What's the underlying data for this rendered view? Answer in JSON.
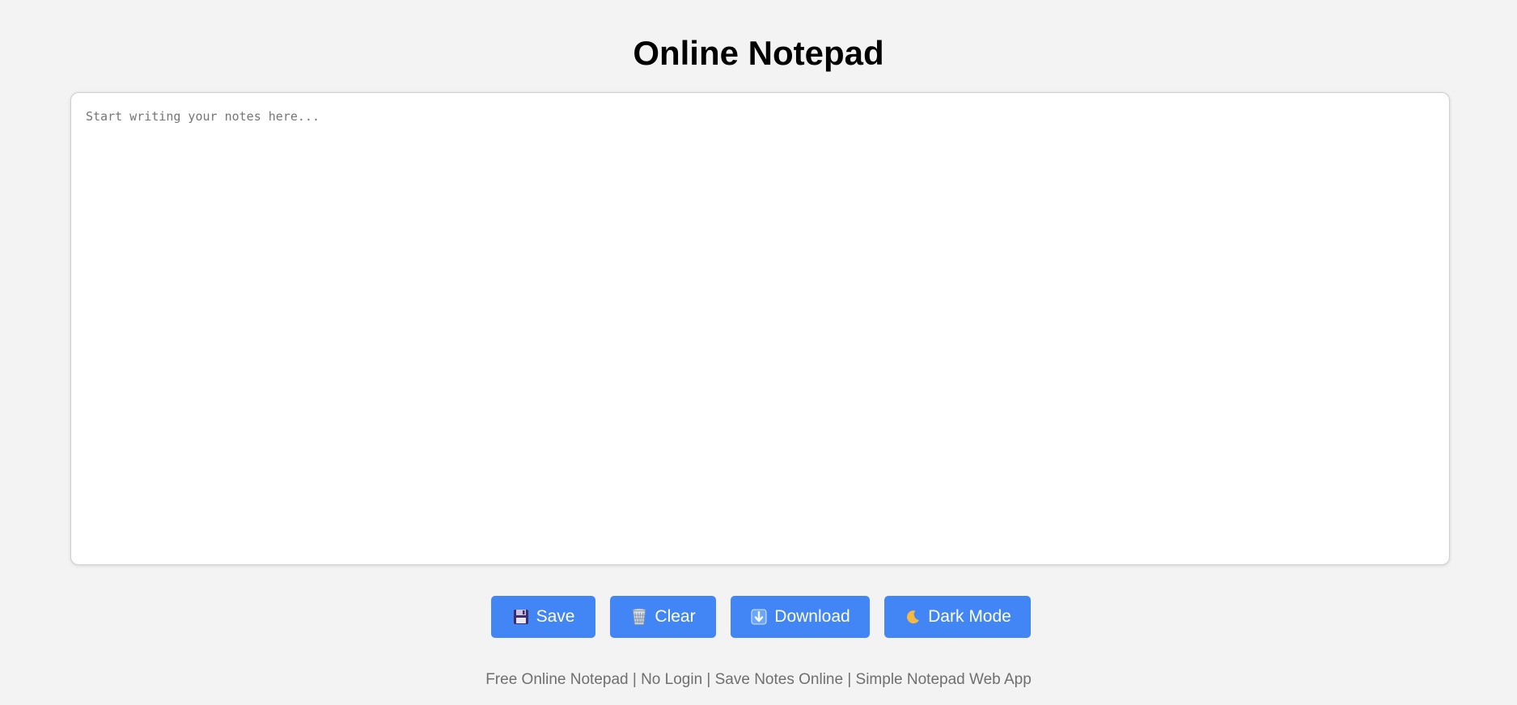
{
  "header": {
    "title": "Online Notepad"
  },
  "editor": {
    "placeholder": "Start writing your notes here...",
    "value": ""
  },
  "toolbar": {
    "buttons": [
      {
        "label": "Save",
        "icon": "floppy-disk-icon"
      },
      {
        "label": "Clear",
        "icon": "wastebasket-icon"
      },
      {
        "label": "Download",
        "icon": "down-arrow-icon"
      },
      {
        "label": "Dark Mode",
        "icon": "crescent-moon-icon"
      }
    ]
  },
  "footer": {
    "text": "Free Online Notepad | No Login | Save Notes Online | Simple Notepad Web App"
  },
  "colors": {
    "background": "#f3f3f3",
    "button": "#4285f4",
    "button_text": "#ffffff",
    "footer_text": "#6f6f6f"
  }
}
